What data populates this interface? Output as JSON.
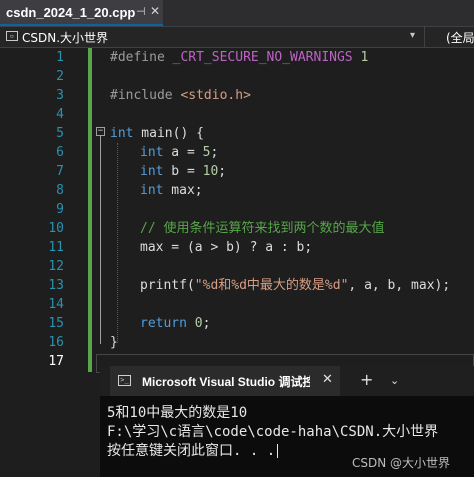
{
  "tab": {
    "title": "csdn_2024_1_20.cpp",
    "pin": "⊣",
    "close": "✕"
  },
  "navbar": {
    "project": "CSDN.大小世界",
    "dropdown": "▾",
    "scope": "(全局"
  },
  "editor": {
    "line_numbers": [
      "1",
      "2",
      "3",
      "4",
      "5",
      "6",
      "7",
      "8",
      "9",
      "10",
      "11",
      "12",
      "13",
      "14",
      "15",
      "16",
      "17"
    ],
    "line1": {
      "directive": "#define",
      "macro": "_CRT_SECURE_NO_WARNINGS",
      "value": "1"
    },
    "line3": {
      "directive": "#include",
      "header": "<stdio.h>"
    },
    "line5": {
      "type": "int",
      "rest": " main() {"
    },
    "line6": {
      "type": "int",
      "name": " a = ",
      "num": "5",
      "end": ";"
    },
    "line7": {
      "type": "int",
      "name": " b = ",
      "num": "10",
      "end": ";"
    },
    "line8": {
      "type": "int",
      "rest": " max;"
    },
    "line10": {
      "comment": "// 使用条件运算符来找到两个数的最大值"
    },
    "line11": {
      "code": "max = (a > b) ? a : b;"
    },
    "line13": {
      "fn": "printf(",
      "str": "\"%d和%d中最大的数是%d\"",
      "rest": ", a, b, max);"
    },
    "line15": {
      "kw": "return",
      "num": "0",
      "end": ";"
    },
    "line16": {
      "code": "}"
    }
  },
  "console": {
    "title": "Microsoft Visual Studio 调试控制台",
    "close": "✕",
    "new_tab": "+",
    "dropdown": "⌄",
    "lines": [
      "5和10中最大的数是10",
      "F:\\学习\\c语言\\code\\code-haha\\CSDN.大小世界",
      "按任意键关闭此窗口. . ."
    ]
  },
  "watermark": "CSDN @大小世界"
}
